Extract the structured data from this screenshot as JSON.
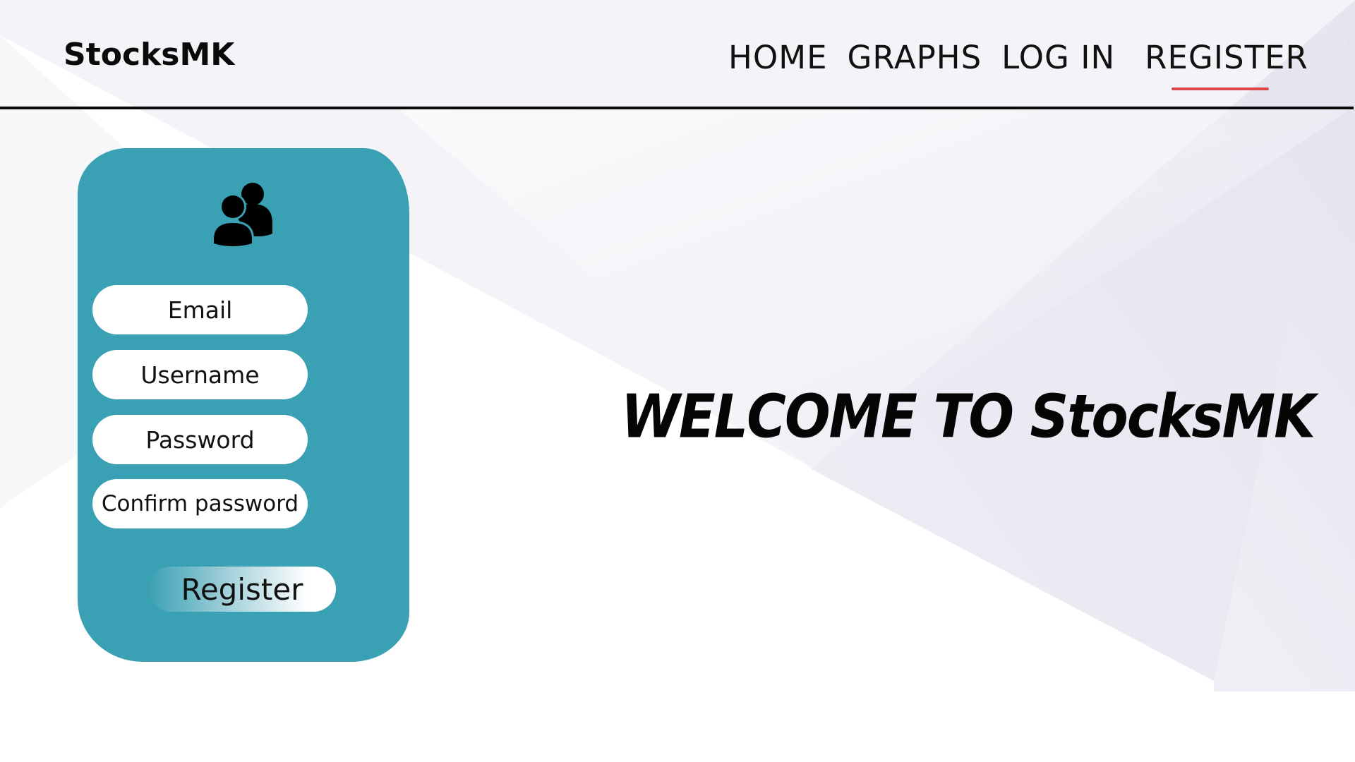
{
  "brand": "StocksMK",
  "nav": {
    "home": "HOME",
    "graphs": "GRAPHS",
    "login": "LOG IN",
    "register": "REGISTER",
    "active": "REGISTER",
    "active_color": "#d9474a"
  },
  "form": {
    "icon": "users-icon",
    "email_placeholder": "Email",
    "username_placeholder": "Username",
    "password_placeholder": "Password",
    "confirm_password_placeholder": "Confirm password",
    "submit_label": "Register",
    "card_color": "#3aa0b3"
  },
  "hero": {
    "title": "WELCOME TO StocksMK"
  }
}
